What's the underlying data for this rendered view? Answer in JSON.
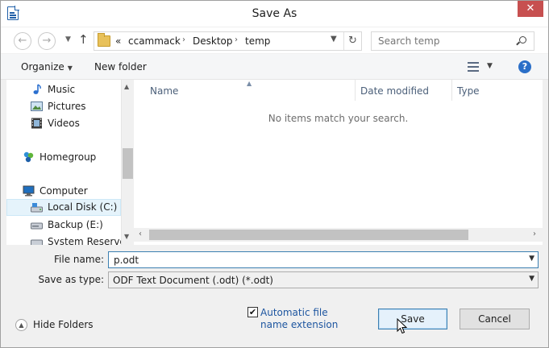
{
  "window": {
    "title": "Save As",
    "close_glyph": "✕"
  },
  "nav": {
    "back_glyph": "←",
    "forward_glyph": "→",
    "up_glyph": "↑",
    "breadcrumb": [
      "«",
      "ccammack",
      "Desktop",
      "temp"
    ],
    "breadcrumb_sep": "›",
    "refresh_glyph": "↻",
    "search_placeholder": "Search temp"
  },
  "toolbar": {
    "organize": "Organize",
    "new_folder": "New folder",
    "help": "?"
  },
  "sidebar": {
    "items": [
      {
        "label": "Music",
        "icon": "music-icon"
      },
      {
        "label": "Pictures",
        "icon": "pictures-icon"
      },
      {
        "label": "Videos",
        "icon": "videos-icon"
      },
      {
        "label": "Homegroup",
        "icon": "homegroup-icon"
      },
      {
        "label": "Computer",
        "icon": "computer-icon"
      },
      {
        "label": "Local Disk (C:)",
        "icon": "drive-icon",
        "selected": true
      },
      {
        "label": "Backup (E:)",
        "icon": "drive-icon"
      },
      {
        "label": "System Reserved",
        "icon": "drive-icon"
      }
    ]
  },
  "filelist": {
    "columns": [
      "Name",
      "Date modified",
      "Type"
    ],
    "empty_message": "No items match your search."
  },
  "form": {
    "filename_label": "File name:",
    "filename_value": "p.odt",
    "filetype_label": "Save as type:",
    "filetype_value": "ODF Text Document (.odt) (*.odt)"
  },
  "footer": {
    "hide_folders": "Hide Folders",
    "auto_ext_label": "Automatic file name extension",
    "auto_ext_checked": true,
    "save": "Save",
    "cancel": "Cancel"
  },
  "colors": {
    "accent": "#3c7fb1",
    "close": "#c75050",
    "link": "#1e56a0"
  }
}
